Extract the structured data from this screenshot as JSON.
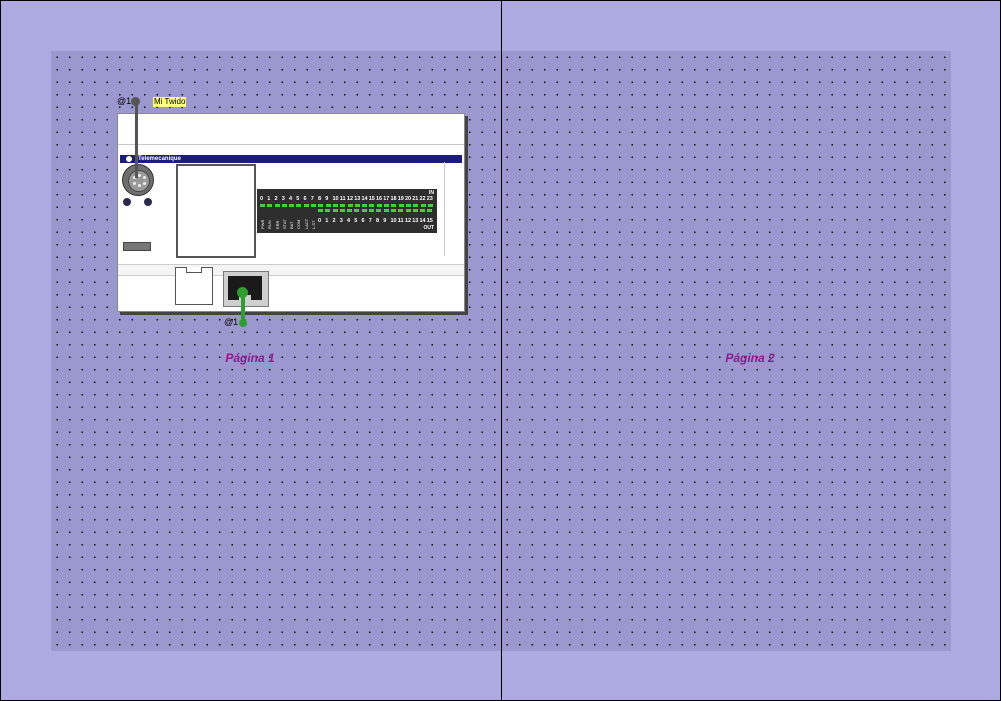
{
  "pages": [
    {
      "label": "Página 1"
    },
    {
      "label": "Página 2"
    }
  ],
  "device": {
    "name": "Mi Twido",
    "address_top": "@1",
    "address_bottom": "@1",
    "brand": "Telemecanique",
    "led_panel": {
      "in_label": "IN",
      "out_label": "OUT",
      "input_numbers": [
        "0",
        "1",
        "2",
        "3",
        "4",
        "5",
        "6",
        "7",
        "8",
        "9",
        "10",
        "11",
        "12",
        "13",
        "14",
        "15",
        "16",
        "17",
        "18",
        "19",
        "20",
        "21",
        "22",
        "23"
      ],
      "output_numbers": [
        "0",
        "1",
        "2",
        "3",
        "4",
        "5",
        "6",
        "7",
        "8",
        "9",
        "10",
        "11",
        "12",
        "13",
        "14",
        "15"
      ],
      "status_labels": [
        "PWR",
        "RUN",
        "ERR",
        "STAT",
        "BAT",
        "COM",
        "LACT",
        "L.ST"
      ]
    }
  },
  "colors": {
    "canvas": "#adaae2",
    "page_area": "#9b98d0",
    "page_label": "#8b1a8b",
    "cable_gray": "#555555",
    "cable_green": "#2e9e2e",
    "led_on": "#3dd13d",
    "brand_bar": "#1c1c7a",
    "name_highlight": "#ffff80"
  }
}
